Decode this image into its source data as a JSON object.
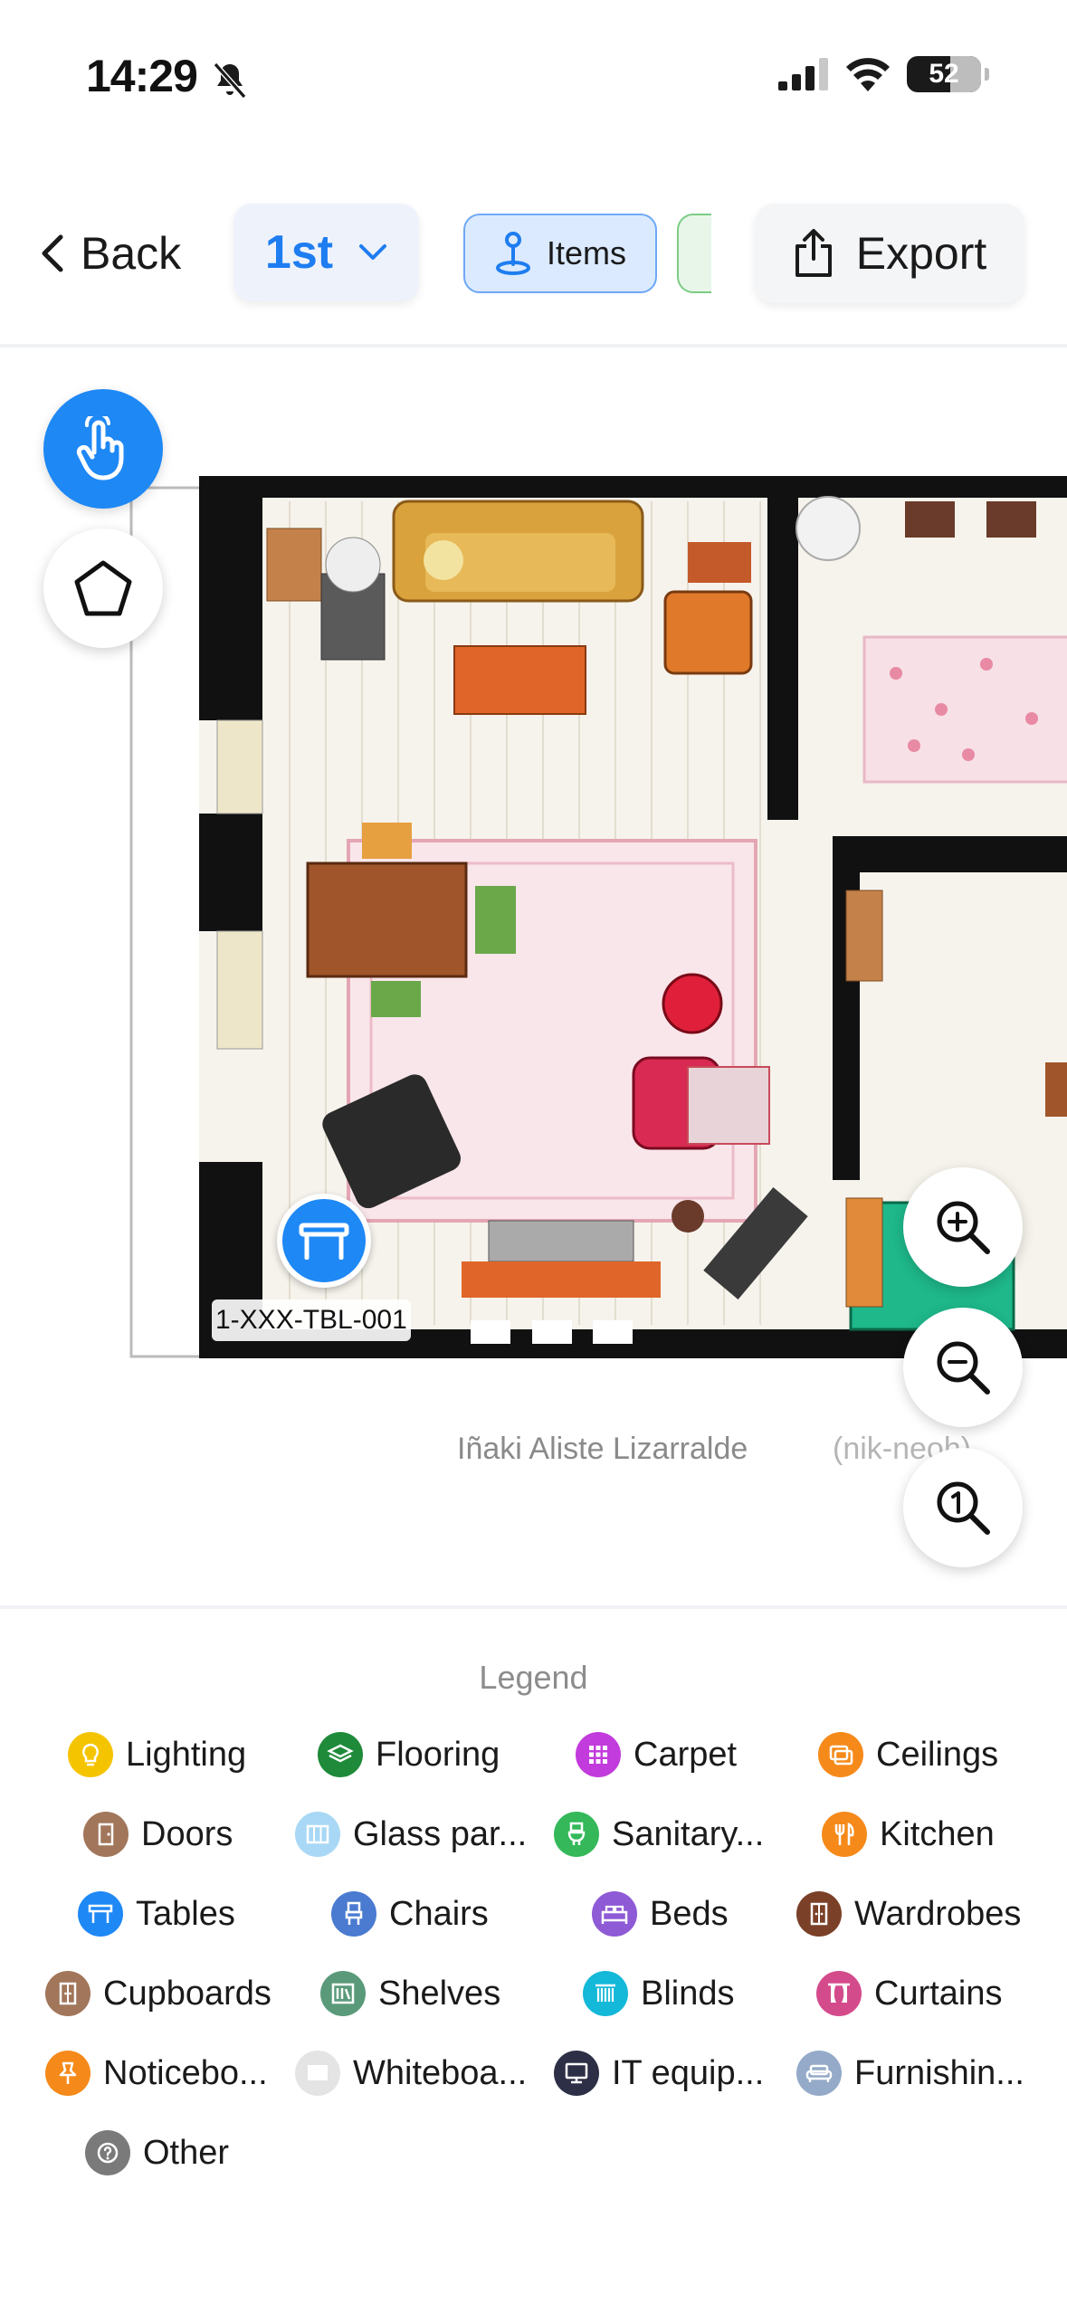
{
  "status_bar": {
    "time": "14:29",
    "battery": "52"
  },
  "toolbar": {
    "back_label": "Back",
    "floor_label": "1st",
    "items_label": "Items",
    "export_label": "Export"
  },
  "map": {
    "pin_label": "1-XXX-TBL-001",
    "credit": "Iñaki Aliste Lizarralde",
    "credit_suffix": "(nik-neoh)"
  },
  "legend": {
    "title": "Legend",
    "items": [
      {
        "label": "Lighting",
        "icon": "lightbulb-icon",
        "color": "#f5c400"
      },
      {
        "label": "Flooring",
        "icon": "layers-icon",
        "color": "#1e8a3a"
      },
      {
        "label": "Carpet",
        "icon": "grid-icon",
        "color": "#c23bdc"
      },
      {
        "label": "Ceilings",
        "icon": "ceiling-icon",
        "color": "#f58a1a"
      },
      {
        "label": "Doors",
        "icon": "door-icon",
        "color": "#a1765a"
      },
      {
        "label": "Glass par...",
        "icon": "glass-partition-icon",
        "color": "#a8d8f5"
      },
      {
        "label": "Sanitary...",
        "icon": "toilet-icon",
        "color": "#34b85a"
      },
      {
        "label": "Kitchen",
        "icon": "cutlery-icon",
        "color": "#f58a1a"
      },
      {
        "label": "Tables",
        "icon": "table-icon",
        "color": "#1e88f5"
      },
      {
        "label": "Chairs",
        "icon": "chair-icon",
        "color": "#4a7bd0"
      },
      {
        "label": "Beds",
        "icon": "bed-icon",
        "color": "#8e5ad6"
      },
      {
        "label": "Wardrobes",
        "icon": "wardrobe-icon",
        "color": "#7a4028"
      },
      {
        "label": "Cupboards",
        "icon": "cupboard-icon",
        "color": "#a1765a"
      },
      {
        "label": "Shelves",
        "icon": "shelves-icon",
        "color": "#5a9a7a"
      },
      {
        "label": "Blinds",
        "icon": "blinds-icon",
        "color": "#14b8d8"
      },
      {
        "label": "Curtains",
        "icon": "curtains-icon",
        "color": "#d44b8c"
      },
      {
        "label": "Noticebo...",
        "icon": "pushpin-icon",
        "color": "#f58a1a"
      },
      {
        "label": "Whiteboa...",
        "icon": "whiteboard-icon",
        "color": "#d8d8d8"
      },
      {
        "label": "IT equip...",
        "icon": "monitor-icon",
        "color": "#2c2f45"
      },
      {
        "label": "Furnishin...",
        "icon": "sofa-icon",
        "color": "#94aac8"
      },
      {
        "label": "Other",
        "icon": "question-icon",
        "color": "#7a7a7a"
      }
    ]
  }
}
